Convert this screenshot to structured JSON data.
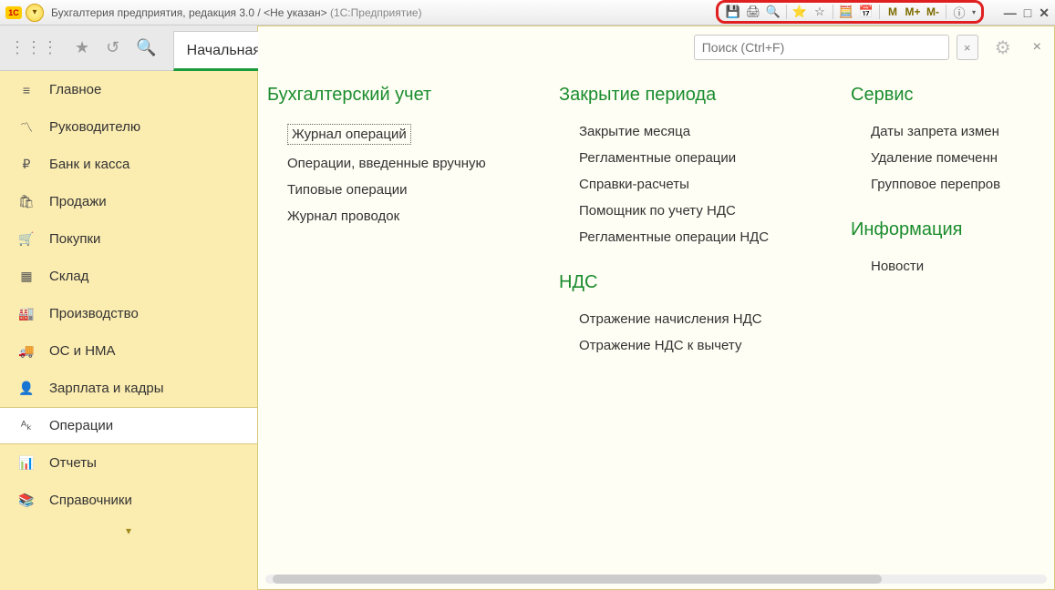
{
  "window": {
    "app_icon_text": "1C",
    "title_main": "Бухгалтерия предприятия, редакция 3.0 / <Не указан>",
    "title_suffix": "(1С:Предприятие)"
  },
  "toolbar": {
    "mem_m": "M",
    "mem_mplus": "M+",
    "mem_mminus": "M-"
  },
  "tabs": {
    "start_label": "Начальная"
  },
  "sidebar": {
    "items": [
      {
        "icon": "≡",
        "label": "Главное"
      },
      {
        "icon": "〽",
        "label": "Руководителю"
      },
      {
        "icon": "₽",
        "label": "Банк и касса"
      },
      {
        "icon": "🛍",
        "label": "Продажи"
      },
      {
        "icon": "🛒",
        "label": "Покупки"
      },
      {
        "icon": "▦",
        "label": "Склад"
      },
      {
        "icon": "🏭",
        "label": "Производство"
      },
      {
        "icon": "🚚",
        "label": "ОС и НМА"
      },
      {
        "icon": "👤",
        "label": "Зарплата и кадры"
      },
      {
        "icon": "ᴬₖ",
        "label": "Операции"
      },
      {
        "icon": "📊",
        "label": "Отчеты"
      },
      {
        "icon": "📚",
        "label": "Справочники"
      }
    ],
    "more": "▾"
  },
  "search": {
    "placeholder": "Поиск (Ctrl+F)",
    "clear": "×",
    "close": "×"
  },
  "content": {
    "col1": {
      "title": "Бухгалтерский учет",
      "items": [
        "Журнал операций",
        "Операции, введенные вручную",
        "Типовые операции",
        "Журнал проводок"
      ]
    },
    "col2a": {
      "title": "Закрытие периода",
      "items": [
        "Закрытие месяца",
        "Регламентные операции",
        "Справки-расчеты",
        "Помощник по учету НДС",
        "Регламентные операции НДС"
      ]
    },
    "col2b": {
      "title": "НДС",
      "items": [
        "Отражение начисления НДС",
        "Отражение НДС к вычету"
      ]
    },
    "col3a": {
      "title": "Сервис",
      "items": [
        "Даты запрета измен",
        "Удаление помеченн",
        "Групповое перепров"
      ]
    },
    "col3b": {
      "title": "Информация",
      "items": [
        "Новости"
      ]
    }
  }
}
